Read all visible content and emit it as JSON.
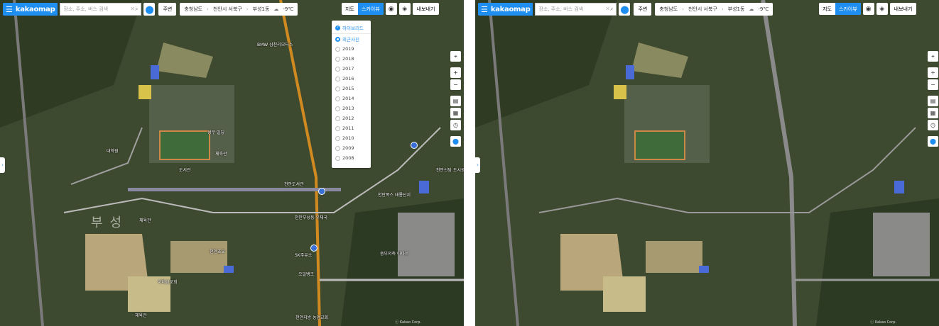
{
  "topbar": {
    "logo": "kakaomap",
    "search_placeholder": "장소, 주소, 버스 검색",
    "around_label": "주변",
    "breadcrumb": [
      "충청남도",
      "천안시 서북구",
      "부성1동"
    ],
    "weather": "-9℃"
  },
  "map_type": {
    "map_label": "지도",
    "skyview_label": "스카이뷰",
    "share_label": "내보내기"
  },
  "year_panel": {
    "hybrid_label": "하이브리드",
    "items": [
      "최근사진",
      "2019",
      "2018",
      "2017",
      "2016",
      "2015",
      "2014",
      "2013",
      "2012",
      "2011",
      "2010",
      "2009",
      "2008"
    ],
    "selected": "최근사진"
  },
  "labels": {
    "l1": "BMW 삼천리모터스",
    "l2": "성무 빌딩",
    "l3": "체육관",
    "l4": "대학원",
    "l5": "도서관",
    "l6": "천안도서관",
    "l7": "부성",
    "l8": "천안부성동 우체국",
    "l9": "체육관",
    "l10": "중부저축 아파트",
    "l11": "SK주유소",
    "l12": "오일뱅크",
    "l13": "천안초교",
    "l14": "이레성교회",
    "l15": "천안지방 농업교회",
    "l16": "체육관",
    "l17": "천안신당 도시공원",
    "l18": "천안폭스 태룡단지"
  },
  "copyright": "ⓒ Kakao Corp."
}
